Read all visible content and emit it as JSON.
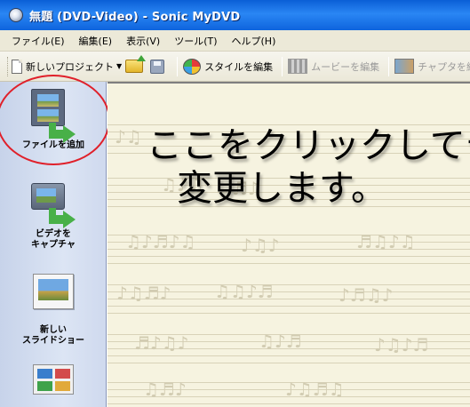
{
  "window": {
    "title": "無題 (DVD-Video) - Sonic MyDVD"
  },
  "menu": [
    "ファイル(E)",
    "編集(E)",
    "表示(V)",
    "ツール(T)",
    "ヘルプ(H)"
  ],
  "toolbar": {
    "new_project": "新しいプロジェクト",
    "edit_style": "スタイルを編集",
    "edit_movie": "ムービーを編集",
    "edit_chapter": "チャプタを編集"
  },
  "sidebar": {
    "add_file": "ファイルを追加",
    "capture_video_1": "ビデオを",
    "capture_video_2": "キャプチャ",
    "new_slideshow_1": "新しい",
    "new_slideshow_2": "スライドショー"
  },
  "canvas": {
    "title_line1": "ここをクリックしてテキ",
    "title_line2": "変更します。"
  }
}
